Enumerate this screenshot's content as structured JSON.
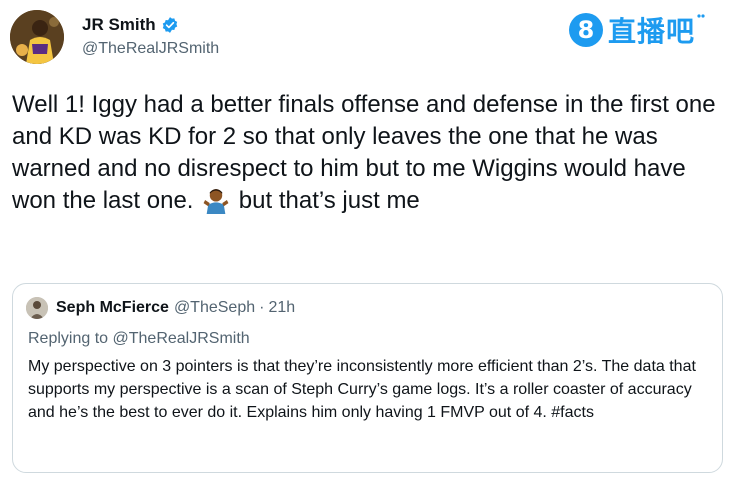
{
  "author": {
    "name": "JR Smith",
    "handle": "@TheRealJRSmith",
    "verified_icon": "verified-badge-icon",
    "verified_color": "#1d9bf0"
  },
  "watermark": {
    "number": "8",
    "text": "直播吧"
  },
  "tweet": {
    "text_before_emoji": "Well 1! Iggy had a better finals offense and defense in the first one and KD was KD for 2 so that only leaves the one that he was warned and no disrespect to him but to me Wiggins would have won the last one.",
    "emoji": "person-shrugging-emoji",
    "text_after_emoji": "but that’s just me"
  },
  "quoted_tweet": {
    "name": "Seph McFierce",
    "handle": "@TheSeph",
    "separator": "·",
    "time": "21h",
    "replying_prefix": "Replying to",
    "replying_to": "@TheRealJRSmith",
    "text": "My perspective on 3 pointers is that they’re inconsistently more efficient than 2’s. The data that supports my perspective is a scan of Steph Curry’s game logs. It’s a roller coaster of accuracy and he’s the best to ever do it.  Explains him only having 1 FMVP out of 4. #facts"
  },
  "colors": {
    "accent": "#1d9bf0",
    "secondary_text": "#536471",
    "border": "#cfd9de"
  }
}
